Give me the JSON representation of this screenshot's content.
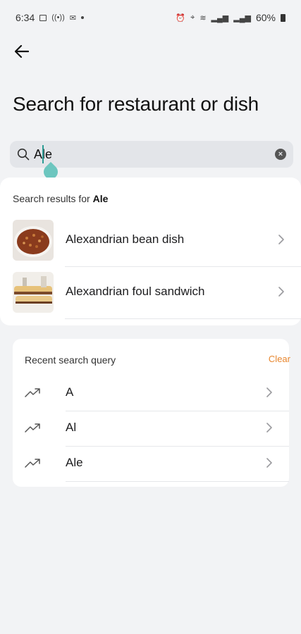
{
  "status_bar": {
    "time": "6:34",
    "battery": "60%"
  },
  "page": {
    "title": "Search for restaurant or dish"
  },
  "search": {
    "value": "Ale",
    "placeholder": ""
  },
  "results": {
    "prefix": "Search results for ",
    "query": "Ale",
    "items": [
      {
        "label": "Alexandrian bean dish",
        "image": "bean-dish-photo"
      },
      {
        "label": "Alexandrian foul sandwich",
        "image": "foul-sandwich-photo"
      }
    ]
  },
  "recent": {
    "heading": "Recent search query",
    "clear_label": "Clear",
    "items": [
      {
        "label": "A"
      },
      {
        "label": "Al"
      },
      {
        "label": "Ale"
      }
    ]
  },
  "colors": {
    "accent_orange": "#e8872f",
    "caret_teal": "#6cc6bf",
    "background": "#f2f3f5"
  },
  "icons": {
    "back": "arrow-left-icon",
    "search": "search-icon",
    "clear": "clear-icon",
    "chevron": "chevron-right-icon",
    "trend": "trending-up-icon"
  }
}
